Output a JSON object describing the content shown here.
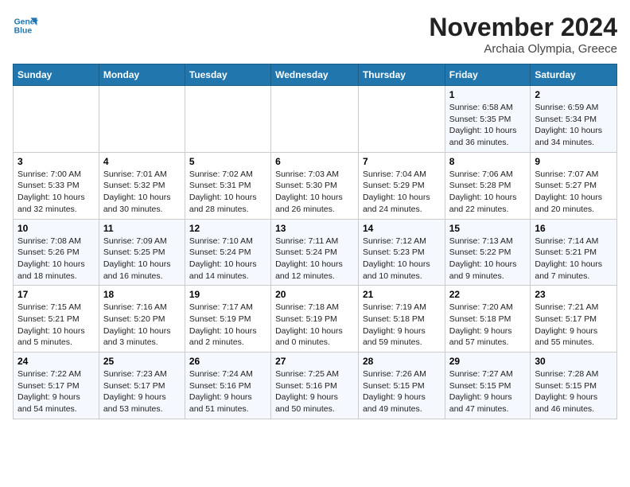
{
  "header": {
    "logo_line1": "General",
    "logo_line2": "Blue",
    "month": "November 2024",
    "location": "Archaia Olympia, Greece"
  },
  "weekdays": [
    "Sunday",
    "Monday",
    "Tuesday",
    "Wednesday",
    "Thursday",
    "Friday",
    "Saturday"
  ],
  "weeks": [
    [
      {
        "day": "",
        "detail": ""
      },
      {
        "day": "",
        "detail": ""
      },
      {
        "day": "",
        "detail": ""
      },
      {
        "day": "",
        "detail": ""
      },
      {
        "day": "",
        "detail": ""
      },
      {
        "day": "1",
        "detail": "Sunrise: 6:58 AM\nSunset: 5:35 PM\nDaylight: 10 hours\nand 36 minutes."
      },
      {
        "day": "2",
        "detail": "Sunrise: 6:59 AM\nSunset: 5:34 PM\nDaylight: 10 hours\nand 34 minutes."
      }
    ],
    [
      {
        "day": "3",
        "detail": "Sunrise: 7:00 AM\nSunset: 5:33 PM\nDaylight: 10 hours\nand 32 minutes."
      },
      {
        "day": "4",
        "detail": "Sunrise: 7:01 AM\nSunset: 5:32 PM\nDaylight: 10 hours\nand 30 minutes."
      },
      {
        "day": "5",
        "detail": "Sunrise: 7:02 AM\nSunset: 5:31 PM\nDaylight: 10 hours\nand 28 minutes."
      },
      {
        "day": "6",
        "detail": "Sunrise: 7:03 AM\nSunset: 5:30 PM\nDaylight: 10 hours\nand 26 minutes."
      },
      {
        "day": "7",
        "detail": "Sunrise: 7:04 AM\nSunset: 5:29 PM\nDaylight: 10 hours\nand 24 minutes."
      },
      {
        "day": "8",
        "detail": "Sunrise: 7:06 AM\nSunset: 5:28 PM\nDaylight: 10 hours\nand 22 minutes."
      },
      {
        "day": "9",
        "detail": "Sunrise: 7:07 AM\nSunset: 5:27 PM\nDaylight: 10 hours\nand 20 minutes."
      }
    ],
    [
      {
        "day": "10",
        "detail": "Sunrise: 7:08 AM\nSunset: 5:26 PM\nDaylight: 10 hours\nand 18 minutes."
      },
      {
        "day": "11",
        "detail": "Sunrise: 7:09 AM\nSunset: 5:25 PM\nDaylight: 10 hours\nand 16 minutes."
      },
      {
        "day": "12",
        "detail": "Sunrise: 7:10 AM\nSunset: 5:24 PM\nDaylight: 10 hours\nand 14 minutes."
      },
      {
        "day": "13",
        "detail": "Sunrise: 7:11 AM\nSunset: 5:24 PM\nDaylight: 10 hours\nand 12 minutes."
      },
      {
        "day": "14",
        "detail": "Sunrise: 7:12 AM\nSunset: 5:23 PM\nDaylight: 10 hours\nand 10 minutes."
      },
      {
        "day": "15",
        "detail": "Sunrise: 7:13 AM\nSunset: 5:22 PM\nDaylight: 10 hours\nand 9 minutes."
      },
      {
        "day": "16",
        "detail": "Sunrise: 7:14 AM\nSunset: 5:21 PM\nDaylight: 10 hours\nand 7 minutes."
      }
    ],
    [
      {
        "day": "17",
        "detail": "Sunrise: 7:15 AM\nSunset: 5:21 PM\nDaylight: 10 hours\nand 5 minutes."
      },
      {
        "day": "18",
        "detail": "Sunrise: 7:16 AM\nSunset: 5:20 PM\nDaylight: 10 hours\nand 3 minutes."
      },
      {
        "day": "19",
        "detail": "Sunrise: 7:17 AM\nSunset: 5:19 PM\nDaylight: 10 hours\nand 2 minutes."
      },
      {
        "day": "20",
        "detail": "Sunrise: 7:18 AM\nSunset: 5:19 PM\nDaylight: 10 hours\nand 0 minutes."
      },
      {
        "day": "21",
        "detail": "Sunrise: 7:19 AM\nSunset: 5:18 PM\nDaylight: 9 hours\nand 59 minutes."
      },
      {
        "day": "22",
        "detail": "Sunrise: 7:20 AM\nSunset: 5:18 PM\nDaylight: 9 hours\nand 57 minutes."
      },
      {
        "day": "23",
        "detail": "Sunrise: 7:21 AM\nSunset: 5:17 PM\nDaylight: 9 hours\nand 55 minutes."
      }
    ],
    [
      {
        "day": "24",
        "detail": "Sunrise: 7:22 AM\nSunset: 5:17 PM\nDaylight: 9 hours\nand 54 minutes."
      },
      {
        "day": "25",
        "detail": "Sunrise: 7:23 AM\nSunset: 5:17 PM\nDaylight: 9 hours\nand 53 minutes."
      },
      {
        "day": "26",
        "detail": "Sunrise: 7:24 AM\nSunset: 5:16 PM\nDaylight: 9 hours\nand 51 minutes."
      },
      {
        "day": "27",
        "detail": "Sunrise: 7:25 AM\nSunset: 5:16 PM\nDaylight: 9 hours\nand 50 minutes."
      },
      {
        "day": "28",
        "detail": "Sunrise: 7:26 AM\nSunset: 5:15 PM\nDaylight: 9 hours\nand 49 minutes."
      },
      {
        "day": "29",
        "detail": "Sunrise: 7:27 AM\nSunset: 5:15 PM\nDaylight: 9 hours\nand 47 minutes."
      },
      {
        "day": "30",
        "detail": "Sunrise: 7:28 AM\nSunset: 5:15 PM\nDaylight: 9 hours\nand 46 minutes."
      }
    ]
  ]
}
